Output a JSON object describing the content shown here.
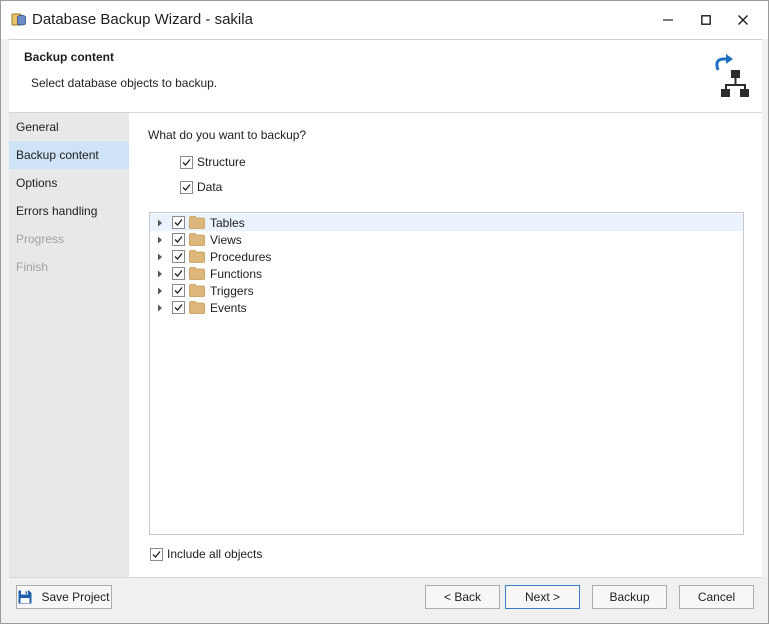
{
  "window": {
    "title": "Database Backup Wizard - sakila"
  },
  "header": {
    "title": "Backup content",
    "subtitle": "Select database objects to backup.",
    "icon": "backup-schema-icon"
  },
  "sidebar": {
    "items": [
      {
        "label": "General",
        "state": "normal"
      },
      {
        "label": "Backup content",
        "state": "active"
      },
      {
        "label": "Options",
        "state": "normal"
      },
      {
        "label": "Errors handling",
        "state": "normal"
      },
      {
        "label": "Progress",
        "state": "disabled"
      },
      {
        "label": "Finish",
        "state": "disabled"
      }
    ]
  },
  "main": {
    "question": "What do you want to backup?",
    "structure": {
      "label": "Structure",
      "checked": true
    },
    "data": {
      "label": "Data",
      "checked": true
    },
    "tree": [
      {
        "label": "Tables",
        "checked": true,
        "highlighted": true
      },
      {
        "label": "Views",
        "checked": true
      },
      {
        "label": "Procedures",
        "checked": true
      },
      {
        "label": "Functions",
        "checked": true
      },
      {
        "label": "Triggers",
        "checked": true
      },
      {
        "label": "Events",
        "checked": true
      }
    ],
    "include_all": {
      "label": "Include all objects",
      "checked": true
    }
  },
  "footer": {
    "save_project": "Save Project",
    "back": "< Back",
    "next": "Next >",
    "backup": "Backup",
    "cancel": "Cancel"
  },
  "colors": {
    "accent": "#3c7fd1",
    "sidebar_active": "#cfe3f7",
    "folder": "#dcb67a"
  }
}
